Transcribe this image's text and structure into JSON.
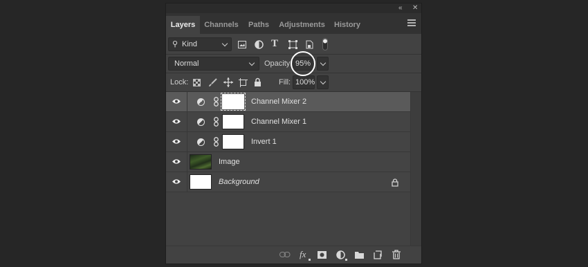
{
  "panel": {
    "titlebar": {
      "collapse_icon": "double-chevron-left-icon",
      "close_icon": "close-icon"
    },
    "tabs": [
      {
        "label": "Layers",
        "active": true
      },
      {
        "label": "Channels",
        "active": false
      },
      {
        "label": "Paths",
        "active": false
      },
      {
        "label": "Adjustments",
        "active": false
      },
      {
        "label": "History",
        "active": false
      }
    ],
    "filter": {
      "search_icon": "search-icon",
      "kind_label": "Kind",
      "filter_icons": [
        "image-filter-icon",
        "adjustment-filter-icon",
        "type-filter-icon",
        "shape-filter-icon",
        "smart-object-filter-icon",
        "filter-toggle-icon"
      ]
    },
    "blend": {
      "mode": "Normal",
      "opacity_label": "Opacity:",
      "opacity_value": "95%"
    },
    "lock": {
      "label": "Lock:",
      "icons": [
        "lock-transparent-pixels-icon",
        "lock-image-pixels-icon",
        "lock-position-icon",
        "lock-artboard-icon",
        "lock-all-icon"
      ],
      "fill_label": "Fill:",
      "fill_value": "100%"
    },
    "layers": [
      {
        "name": "Channel Mixer 2",
        "type": "adjustment",
        "selected": true,
        "italic": false
      },
      {
        "name": "Channel Mixer 1",
        "type": "adjustment",
        "selected": false,
        "italic": false
      },
      {
        "name": "Invert 1",
        "type": "adjustment",
        "selected": false,
        "italic": false
      },
      {
        "name": "Image",
        "type": "image",
        "selected": false,
        "italic": false
      },
      {
        "name": "Background",
        "type": "background",
        "selected": false,
        "italic": true,
        "locked": true
      }
    ],
    "bottom_icons": [
      "link-layers-icon",
      "fx-icon",
      "add-mask-icon",
      "new-adjustment-icon",
      "new-group-icon",
      "new-layer-icon",
      "delete-icon"
    ]
  }
}
